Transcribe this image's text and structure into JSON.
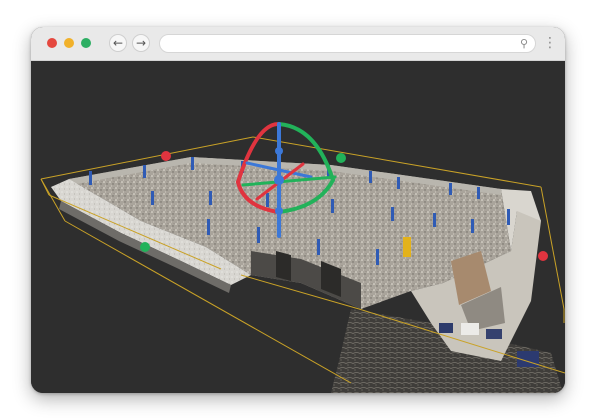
{
  "browser": {
    "controls": {
      "close": "close",
      "minimize": "minimize",
      "maximize": "maximize"
    },
    "back_icon": "←",
    "forward_icon": "→",
    "address": {
      "value": "",
      "placeholder": ""
    },
    "search_icon": "⚲",
    "menu_icon": "⋮"
  },
  "viewport": {
    "background": "#2e2e2e",
    "bbox_color": "#c9a227",
    "handle_colors": {
      "red": "#e0343f",
      "green": "#22b25a"
    },
    "gizmo_colors": {
      "x": "#e0343f",
      "y": "#22b25a",
      "z": "#3c78d8"
    },
    "icons": [
      "point-cloud-model-icon",
      "bounding-box-icon",
      "rotation-gizmo-icon",
      "scale-handle-icon"
    ]
  }
}
